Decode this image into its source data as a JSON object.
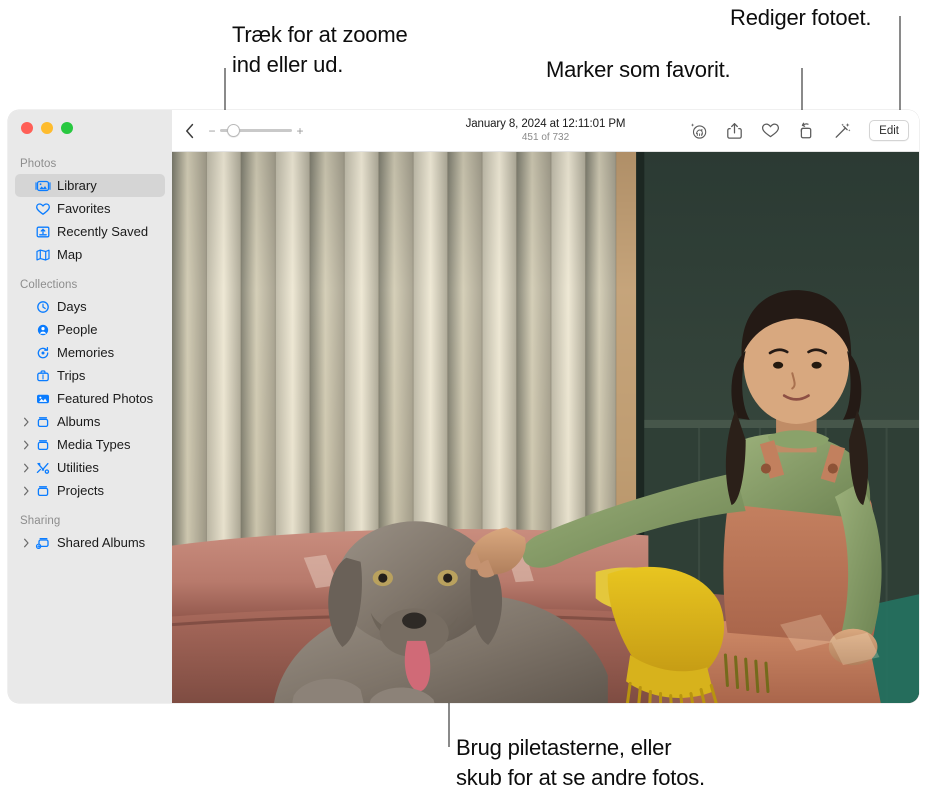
{
  "annotations": [
    {
      "id": "zoom-callout",
      "text": "Træk for at zoome\nind eller ud."
    },
    {
      "id": "favorite-callout",
      "text": "Marker som favorit."
    },
    {
      "id": "edit-callout",
      "text": "Rediger fotoet."
    },
    {
      "id": "swipe-callout",
      "text": "Brug piletasterne, eller\nskub for at se andre fotos."
    }
  ],
  "window": {
    "traffic_lights": [
      {
        "name": "close",
        "color": "#FF5F57"
      },
      {
        "name": "minimize",
        "color": "#FEBC2E"
      },
      {
        "name": "zoom",
        "color": "#28C840"
      }
    ]
  },
  "sidebar": {
    "accent_color": "#0A7CFF",
    "groups": [
      {
        "header": "Photos",
        "items": [
          {
            "label": "Library",
            "icon": "photos-library-icon",
            "selected": true,
            "disclosure": false
          },
          {
            "label": "Favorites",
            "icon": "heart-icon",
            "selected": false,
            "disclosure": false
          },
          {
            "label": "Recently Saved",
            "icon": "recently-saved-icon",
            "selected": false,
            "disclosure": false
          },
          {
            "label": "Map",
            "icon": "map-icon",
            "selected": false,
            "disclosure": false
          }
        ]
      },
      {
        "header": "Collections",
        "items": [
          {
            "label": "Days",
            "icon": "clock-icon",
            "selected": false,
            "disclosure": false
          },
          {
            "label": "People",
            "icon": "person-circle-icon",
            "selected": false,
            "disclosure": false
          },
          {
            "label": "Memories",
            "icon": "memories-icon",
            "selected": false,
            "disclosure": false
          },
          {
            "label": "Trips",
            "icon": "suitcase-icon",
            "selected": false,
            "disclosure": false
          },
          {
            "label": "Featured Photos",
            "icon": "featured-photos-icon",
            "selected": false,
            "disclosure": false
          },
          {
            "label": "Albums",
            "icon": "album-icon",
            "selected": false,
            "disclosure": true
          },
          {
            "label": "Media Types",
            "icon": "album-icon",
            "selected": false,
            "disclosure": true
          },
          {
            "label": "Utilities",
            "icon": "utilities-icon",
            "selected": false,
            "disclosure": true
          },
          {
            "label": "Projects",
            "icon": "album-icon",
            "selected": false,
            "disclosure": true
          }
        ]
      },
      {
        "header": "Sharing",
        "items": [
          {
            "label": "Shared Albums",
            "icon": "shared-album-icon",
            "selected": false,
            "disclosure": true
          }
        ]
      }
    ]
  },
  "toolbar": {
    "back_icon": "chevron-left-icon",
    "zoom_out_label": "−",
    "zoom_in_label": "+",
    "zoom_value": 10,
    "title": "January 8, 2024 at 12:11:01 PM",
    "subtitle": "451 of 732",
    "actions": [
      {
        "name": "visual-lookup-icon",
        "label": "Visual Look Up"
      },
      {
        "name": "share-icon",
        "label": "Share"
      },
      {
        "name": "heart-icon",
        "label": "Favorite"
      },
      {
        "name": "rotate-icon",
        "label": "Rotate"
      },
      {
        "name": "auto-enhance-icon",
        "label": "Auto Enhance"
      }
    ],
    "edit_label": "Edit"
  },
  "photo": {
    "alt": "A girl in a green shirt and orange overalls sits on a pink couch petting a grey Weimaraner dog, with vertical blinds behind them and a yellow fringed blanket on the couch."
  }
}
